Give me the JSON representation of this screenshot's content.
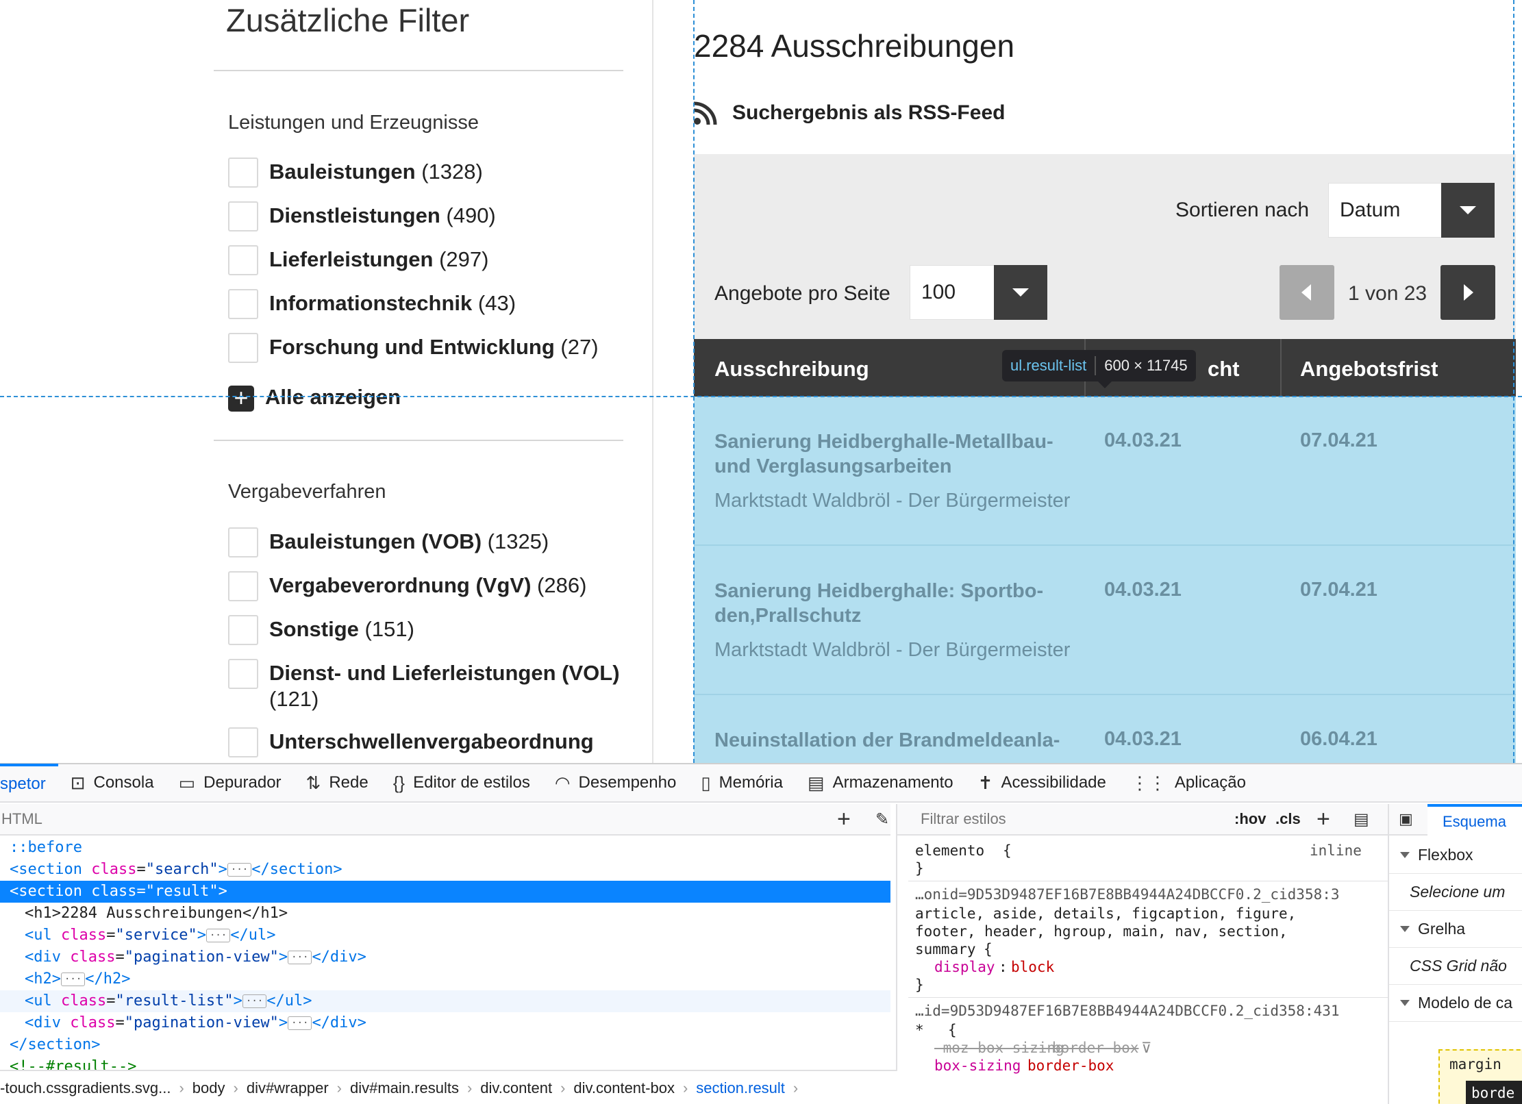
{
  "filters": {
    "title": "Zusätzliche Filter",
    "group1": {
      "heading": "Leistungen und Erzeugnisse",
      "items": [
        {
          "label": "Bauleistungen",
          "count": "(1328)"
        },
        {
          "label": "Dienstleistungen",
          "count": "(490)"
        },
        {
          "label": "Lieferleistungen",
          "count": "(297)"
        },
        {
          "label": "Informationstechnik",
          "count": "(43)"
        },
        {
          "label": "Forschung und Entwicklung",
          "count": "(27)"
        }
      ],
      "show_all": "Alle anzeigen"
    },
    "group2": {
      "heading": "Vergabeverfahren",
      "items": [
        {
          "label": "Bauleistungen (VOB)",
          "count": "(1325)"
        },
        {
          "label": "Vergabeverordnung (VgV)",
          "count": "(286)"
        },
        {
          "label": "Sonstige",
          "count": "(151)"
        },
        {
          "label": "Dienst- und Lieferleistungen (VOL)",
          "count": "(121)"
        },
        {
          "label": "Unterschwellenvergabeordnung",
          "count": ""
        }
      ]
    }
  },
  "results": {
    "title": "2284 Ausschreibungen",
    "rss": "Suchergebnis als RSS-Feed",
    "sort_label": "Sortieren nach",
    "sort_value": "Datum",
    "per_page_label": "Angebote pro Seite",
    "per_page_value": "100",
    "page_info": "1 von 23",
    "columns": [
      "Ausschreibung",
      "cht",
      "Angebotsfrist"
    ],
    "rows": [
      {
        "title": "Sanierung Heidberghalle-Metallbau-und Verglasungsarbeiten",
        "date": "04.03.21",
        "deadline": "07.04.21",
        "org": "Marktstadt Waldbröl - Der Bürgermeister"
      },
      {
        "title": "Sanierung Heidberghalle: Sportbo-den,Prallschutz",
        "date": "04.03.21",
        "deadline": "07.04.21",
        "org": "Marktstadt Waldbröl - Der Bürgermeister"
      },
      {
        "title": "Neuinstallation der Brandmeldeanla-",
        "date": "04.03.21",
        "deadline": "06.04.21",
        "org": ""
      }
    ],
    "tooltip": {
      "selector": "ul.result-list",
      "size": "600 × 11745"
    }
  },
  "devtools": {
    "tabs": [
      {
        "icon": "inspector-icon",
        "label": "spetor"
      },
      {
        "icon": "console-icon",
        "label": "Consola"
      },
      {
        "icon": "debugger-icon",
        "label": "Depurador"
      },
      {
        "icon": "network-icon",
        "label": "Rede"
      },
      {
        "icon": "style-editor-icon",
        "label": "Editor de estilos"
      },
      {
        "icon": "performance-icon",
        "label": "Desempenho"
      },
      {
        "icon": "memory-icon",
        "label": "Memória"
      },
      {
        "icon": "storage-icon",
        "label": "Armazenamento"
      },
      {
        "icon": "accessibility-icon",
        "label": "Acessibilidade"
      },
      {
        "icon": "application-icon",
        "label": "Aplicação"
      }
    ],
    "html_search_placeholder": "HTML",
    "styles_filter_placeholder": "Filtrar estilos",
    "hov": ":hov",
    "cls": ".cls",
    "layout_tab": "Esquema",
    "tree": [
      "::before",
      "<section class=\"search\">…</section>",
      "<section class=\"result\">",
      "<h1>2284 Ausschreibungen</h1>",
      "<ul class=\"service\">…</ul>",
      "<div class=\"pagination-view\">…</div>",
      "<h2>…</h2>",
      "<ul class=\"result-list\">…</ul>",
      "<div class=\"pagination-view\">…</div>",
      "</section>",
      "<!--#result-->"
    ],
    "breadcrumbs": [
      "-touch.cssgradients.svg...",
      "body",
      "div#wrapper",
      "div#main.results",
      "div.content",
      "div.content-box",
      "section.result"
    ],
    "styles": {
      "element": "elemento",
      "element_inline": "inline",
      "rule1_source": "…onid=9D53D9487EF16B7E8BB4944A24DBCCF0.2_cid358:3",
      "rule1_selector_l1": "article, aside, details, figcaption, figure,",
      "rule1_selector_l2": "footer, header, hgroup, main, nav, section,",
      "rule1_selector_l3": "summary",
      "rule1_prop": "display",
      "rule1_val": "block",
      "rule2_source": "…id=9D53D9487EF16B7E8BB4944A24DBCCF0.2_cid358:431",
      "rule2_selector": "*",
      "rule2_prop1": "-moz-box-sizing",
      "rule2_val1": "border-box",
      "rule2_prop2": "box-sizing",
      "rule2_val2": "border-box"
    },
    "layout": {
      "flexbox": "Flexbox",
      "flex_hint": "Selecione um",
      "grid": "Grelha",
      "grid_hint": "CSS Grid não",
      "boxmodel": "Modelo de ca",
      "margin": "margin",
      "border": "borde"
    }
  }
}
